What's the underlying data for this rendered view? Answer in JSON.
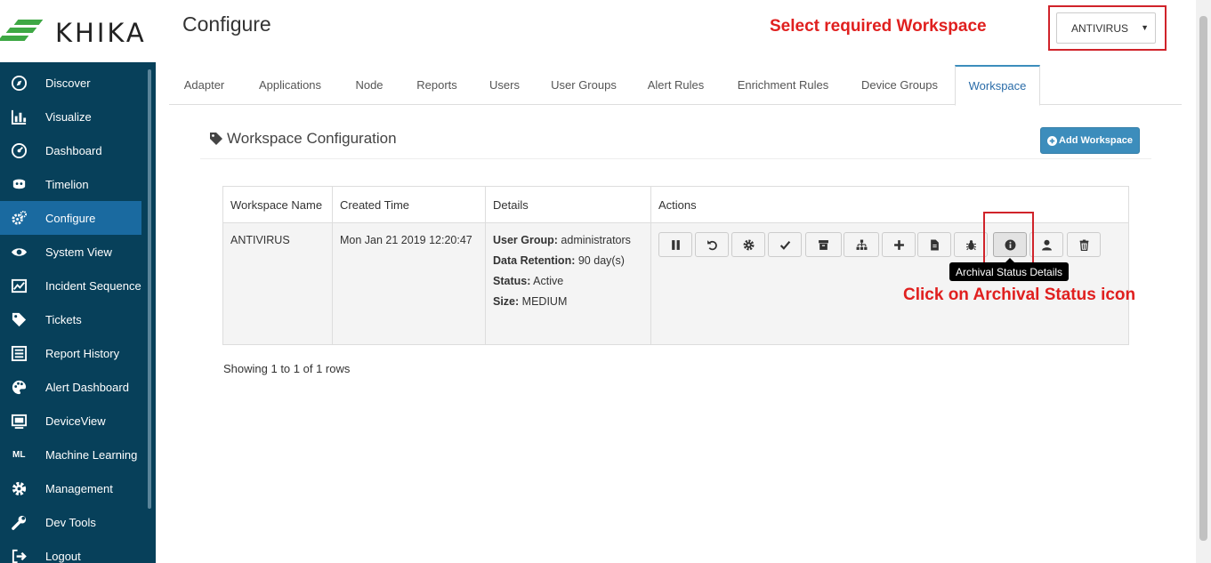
{
  "app": {
    "logo_text": "KHIKA"
  },
  "sidebar": {
    "items": [
      {
        "label": "Discover",
        "icon": "compass-icon"
      },
      {
        "label": "Visualize",
        "icon": "bar-chart-icon"
      },
      {
        "label": "Dashboard",
        "icon": "dashboard-icon"
      },
      {
        "label": "Timelion",
        "icon": "timelion-icon"
      },
      {
        "label": "Configure",
        "icon": "gears-icon",
        "active": true
      },
      {
        "label": "System View",
        "icon": "eye-icon"
      },
      {
        "label": "Incident Sequence",
        "icon": "incident-icon"
      },
      {
        "label": "Tickets",
        "icon": "tag-icon"
      },
      {
        "label": "Report History",
        "icon": "list-icon"
      },
      {
        "label": "Alert Dashboard",
        "icon": "palette-icon"
      },
      {
        "label": "DeviceView",
        "icon": "device-icon"
      },
      {
        "label": "Machine Learning",
        "icon": "ml-icon",
        "icon_text": "ML"
      },
      {
        "label": "Management",
        "icon": "gear-icon"
      },
      {
        "label": "Dev Tools",
        "icon": "wrench-icon"
      },
      {
        "label": "Logout",
        "icon": "logout-icon"
      }
    ]
  },
  "header": {
    "title": "Configure",
    "note": "Select required Workspace",
    "workspace_select": {
      "value": "ANTIVIRUS"
    }
  },
  "tabs": [
    {
      "label": "Adapter"
    },
    {
      "label": "Applications"
    },
    {
      "label": "Node"
    },
    {
      "label": "Reports"
    },
    {
      "label": "Users"
    },
    {
      "label": "User Groups"
    },
    {
      "label": "Alert Rules"
    },
    {
      "label": "Enrichment Rules"
    },
    {
      "label": "Device Groups"
    },
    {
      "label": "Workspace",
      "active": true
    }
  ],
  "section": {
    "title": "Workspace Configuration",
    "add_button": "Add Workspace"
  },
  "table": {
    "headers": [
      "Workspace Name",
      "Created Time",
      "Details",
      "Actions"
    ],
    "row": {
      "name": "ANTIVIRUS",
      "created": "Mon Jan 21 2019 12:20:47",
      "details": [
        {
          "key": "User Group:",
          "value": "administrators"
        },
        {
          "key": "Data Retention:",
          "value": "90 day(s)"
        },
        {
          "key": "Status:",
          "value": "Active"
        },
        {
          "key": "Size:",
          "value": "MEDIUM"
        }
      ],
      "action_icons": [
        "pause-icon",
        "undo-icon",
        "cog-icon",
        "check-icon",
        "archive-icon",
        "sitemap-icon",
        "plus-icon",
        "file-icon",
        "bug-icon",
        "info-icon",
        "user-icon",
        "trash-icon"
      ]
    },
    "footer": "Showing 1 to 1 of 1 rows"
  },
  "tooltip": "Archival Status Details",
  "annotation": "Click on Archival Status icon",
  "colors": {
    "sidebar_bg": "#07405a",
    "sidebar_active": "#1a6aa0",
    "accent": "#3c8dbc",
    "annotation_red": "#e0201f"
  }
}
